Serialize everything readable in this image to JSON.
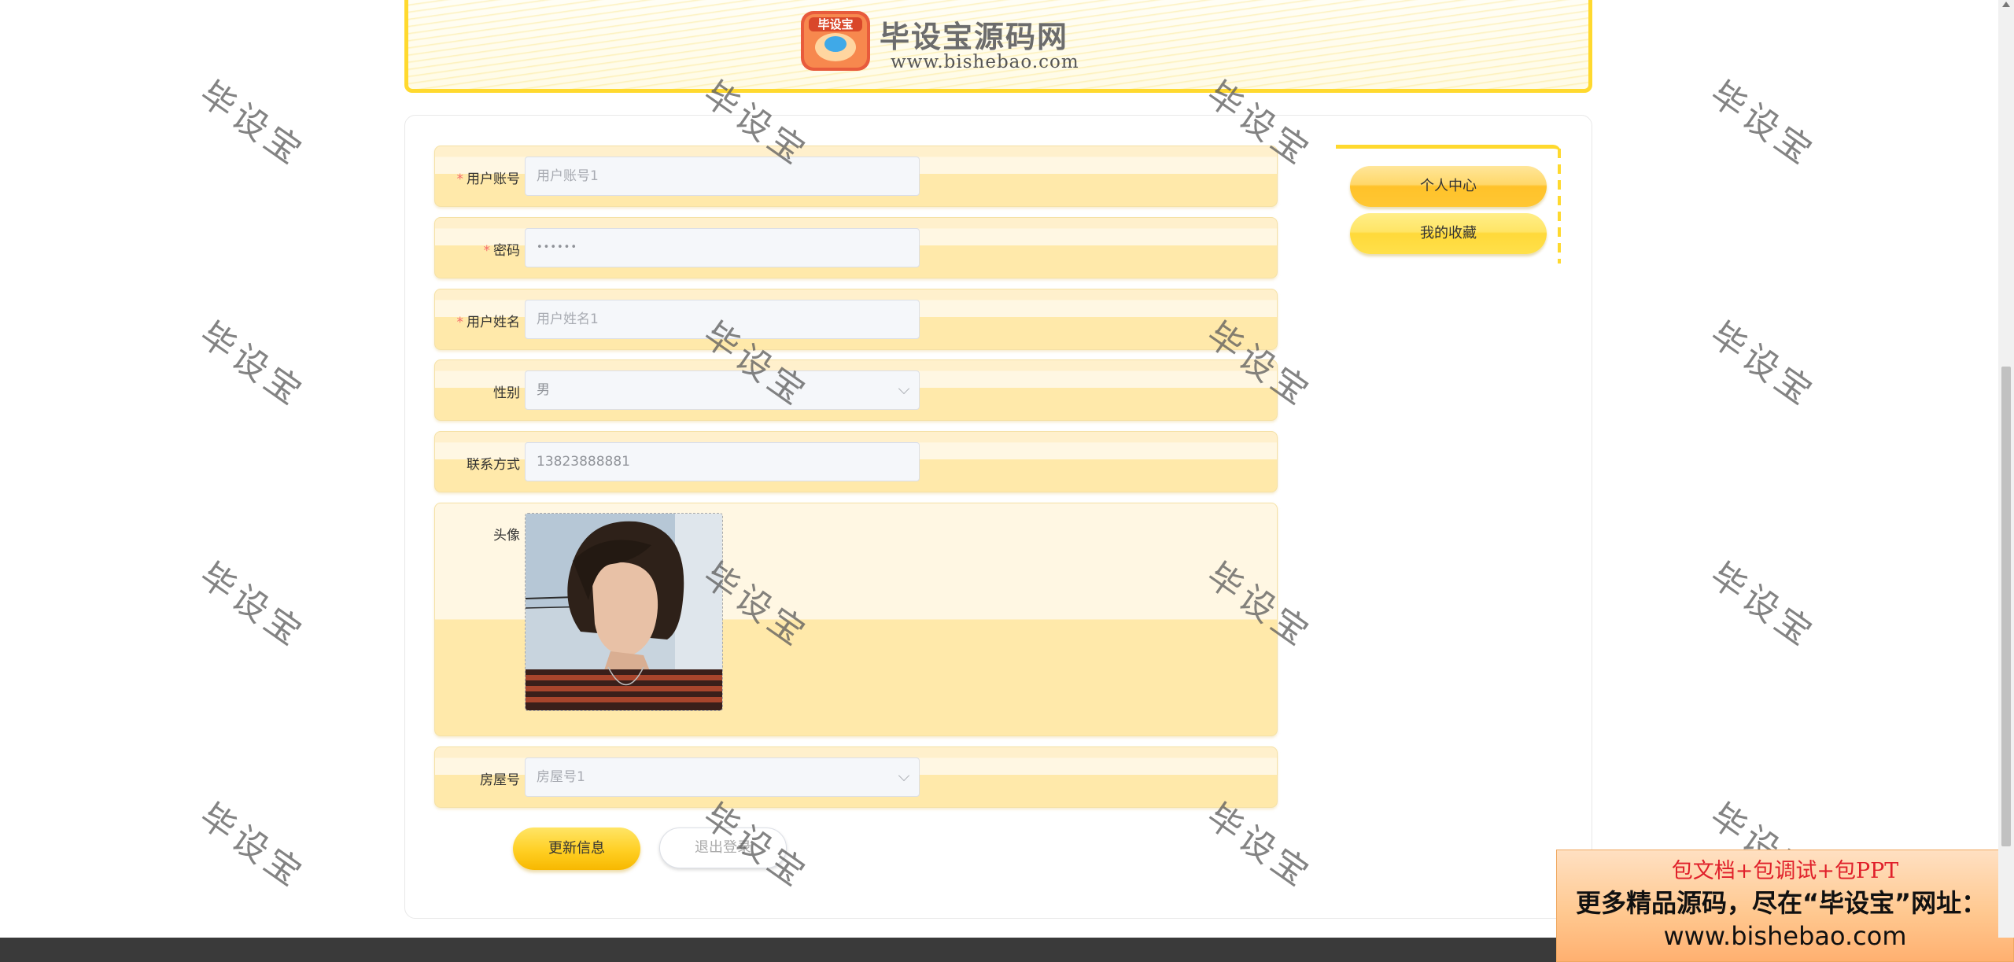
{
  "header": {
    "logo_badge_text": "毕设宝",
    "logo_title": "毕设宝源码网",
    "logo_url": "www.bishebao.com"
  },
  "form": {
    "account": {
      "label": "用户账号",
      "placeholder": "用户账号1",
      "required": true
    },
    "password": {
      "label": "密码",
      "value": "••••••",
      "required": true
    },
    "name": {
      "label": "用户姓名",
      "placeholder": "用户姓名1",
      "required": true
    },
    "gender": {
      "label": "性别",
      "value": "男"
    },
    "contact": {
      "label": "联系方式",
      "value": "13823888881"
    },
    "avatar": {
      "label": "头像"
    },
    "room": {
      "label": "房屋号",
      "placeholder": "房屋号1"
    },
    "required_mark": "*"
  },
  "actions": {
    "update_label": "更新信息",
    "logout_label": "退出登录"
  },
  "side_menu": {
    "items": [
      "个人中心",
      "我的收藏"
    ]
  },
  "watermark": "毕设宝",
  "ad": {
    "line1": "包文档+包调试+包PPT",
    "line2": "更多精品源码，尽在“毕设宝”网址：",
    "line3": "www.bishebao.com"
  },
  "colors": {
    "accent": "#ffd92e",
    "required": "#f56c6c",
    "ad_red": "#e0202a"
  }
}
